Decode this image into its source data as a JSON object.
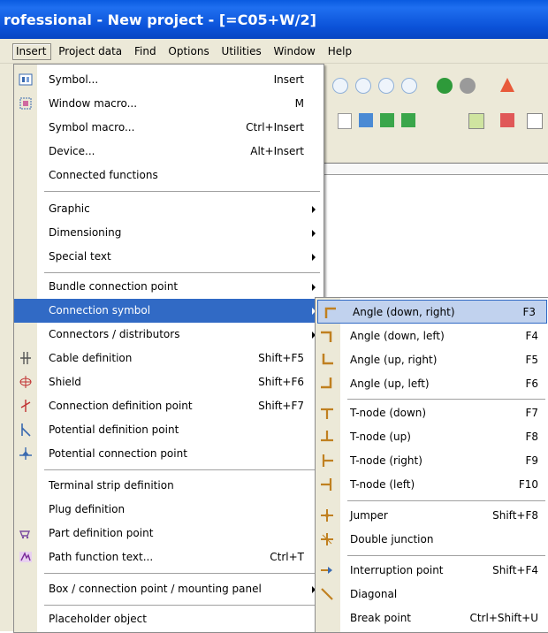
{
  "window": {
    "title": "rofessional - New project - [=C05+W/2]"
  },
  "menubar": [
    "Insert",
    "Project data",
    "Find",
    "Options",
    "Utilities",
    "Window",
    "Help"
  ],
  "insert_menu": {
    "items": [
      {
        "label": "Symbol...",
        "shortcut": "Insert",
        "icon": "symbol-icon"
      },
      {
        "label": "Window macro...",
        "shortcut": "M",
        "icon": "window-macro-icon"
      },
      {
        "label": "Symbol macro...",
        "shortcut": "Ctrl+Insert"
      },
      {
        "label": "Device...",
        "shortcut": "Alt+Insert"
      },
      {
        "label": "Connected functions"
      },
      {
        "label": "Graphic",
        "submenu": true
      },
      {
        "label": "Dimensioning",
        "submenu": true
      },
      {
        "label": "Special text",
        "submenu": true
      },
      {
        "label": "Bundle connection point",
        "submenu": true
      },
      {
        "label": "Connection symbol",
        "submenu": true,
        "highlighted": true
      },
      {
        "label": "Connectors / distributors",
        "submenu": true
      },
      {
        "label": "Cable definition",
        "shortcut": "Shift+F5",
        "icon": "cable-icon"
      },
      {
        "label": "Shield",
        "shortcut": "Shift+F6",
        "icon": "shield-icon"
      },
      {
        "label": "Connection definition point",
        "shortcut": "Shift+F7",
        "icon": "connection-definition-icon"
      },
      {
        "label": "Potential definition point",
        "icon": "potential-definition-icon"
      },
      {
        "label": "Potential connection point",
        "icon": "potential-connection-icon"
      },
      {
        "label": "Terminal strip definition"
      },
      {
        "label": "Plug definition"
      },
      {
        "label": "Part definition point",
        "icon": "part-definition-icon"
      },
      {
        "label": "Path function text...",
        "shortcut": "Ctrl+T",
        "icon": "path-function-icon"
      },
      {
        "label": "Box / connection point / mounting panel",
        "submenu": true
      },
      {
        "label": "Placeholder object"
      }
    ]
  },
  "connection_submenu": {
    "items": [
      {
        "label": "Angle (down, right)",
        "shortcut": "F3",
        "highlighted": true
      },
      {
        "label": "Angle (down, left)",
        "shortcut": "F4"
      },
      {
        "label": "Angle (up, right)",
        "shortcut": "F5"
      },
      {
        "label": "Angle (up, left)",
        "shortcut": "F6"
      },
      {
        "label": "T-node (down)",
        "shortcut": "F7"
      },
      {
        "label": "T-node (up)",
        "shortcut": "F8"
      },
      {
        "label": "T-node (right)",
        "shortcut": "F9"
      },
      {
        "label": "T-node (left)",
        "shortcut": "F10"
      },
      {
        "label": "Jumper",
        "shortcut": "Shift+F8"
      },
      {
        "label": "Double junction"
      },
      {
        "label": "Interruption point",
        "shortcut": "Shift+F4"
      },
      {
        "label": "Diagonal"
      },
      {
        "label": "Break point",
        "shortcut": "Ctrl+Shift+U"
      }
    ]
  },
  "colors": {
    "highlight": "#316ac5",
    "titlebar": "#0a5be0",
    "menubar": "#ece9d8",
    "subhighlight": "#c1d2ee"
  }
}
